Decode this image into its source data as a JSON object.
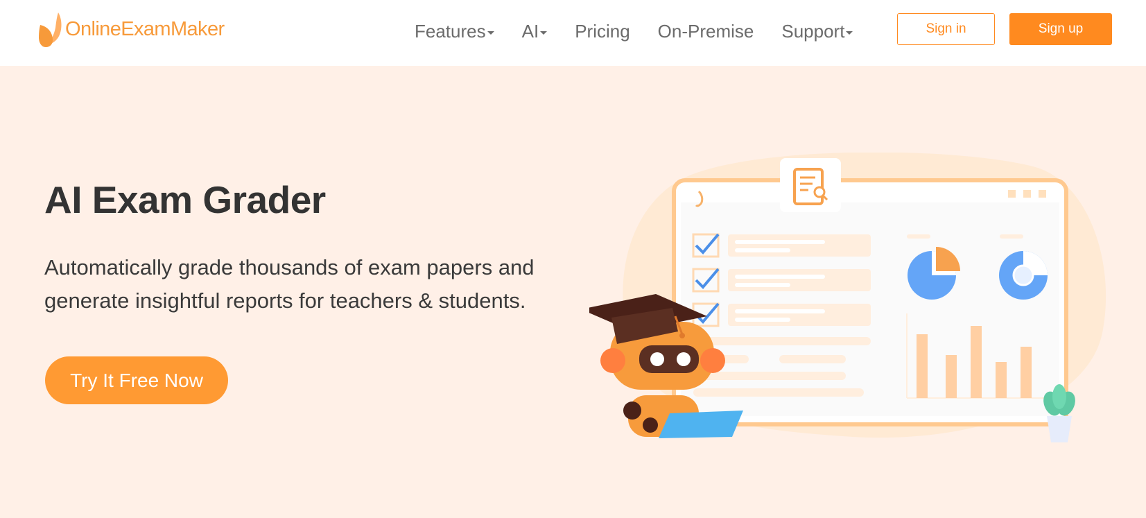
{
  "brand": {
    "name": "OnlineExamMaker",
    "primary_color": "#ff8a1f",
    "logo_icon": "leaf-logo-icon"
  },
  "nav": {
    "items": [
      {
        "label": "Features",
        "dropdown": true
      },
      {
        "label": "AI",
        "dropdown": true
      },
      {
        "label": "Pricing",
        "dropdown": false
      },
      {
        "label": "On-Premise",
        "dropdown": false
      },
      {
        "label": "Support",
        "dropdown": true
      }
    ],
    "sign_in": "Sign in",
    "sign_up": "Sign up"
  },
  "hero": {
    "title": "AI Exam Grader",
    "description": "Automatically grade thousands of exam papers and generate insightful reports for teachers & students.",
    "cta": "Try It Free Now",
    "background_color": "#fff0e7",
    "illustration": "robot-grading-dashboard-illustration"
  }
}
